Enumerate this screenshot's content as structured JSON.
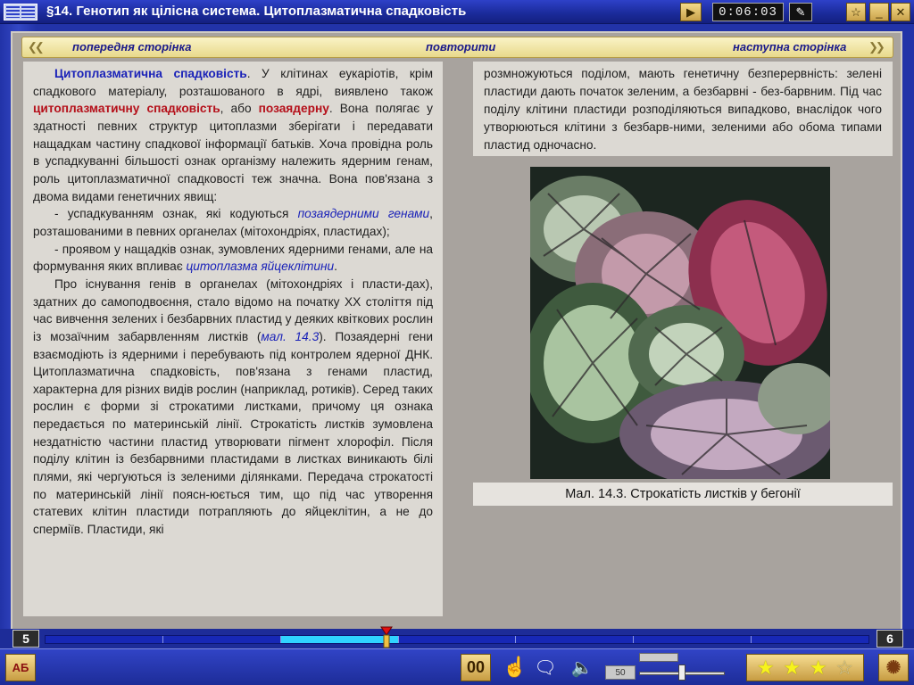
{
  "window": {
    "title": "§14. Генотип як цілісна система. Цитоплазматична спадковість",
    "timer": "0:06:03"
  },
  "nav": {
    "prev_label": "попередня сторінка",
    "repeat_label": "повторити",
    "next_label": "наступна сторінка"
  },
  "left_text": {
    "p1_term": "Цитоплазматична спадковість",
    "p1_a": ". У клітинах еукаріотів, крім спадкового матеріалу, розташованого в ядрі, виявлено також ",
    "p1_term2": "цитоплазматичну спадковість",
    "p1_b": ", або ",
    "p1_term3": "позаядерну",
    "p1_c": ". Вона полягає у здатності певних структур цитоплазми зберігати і передавати нащадкам частину спадкової інформації батьків. Хоча провідна роль в успадкуванні більшості ознак організму належить ядерним генам, роль цитоплазматичної спадковості теж значна. Вона пов'язана з двома видами генетичних явищ:",
    "p2_a": "- успадкуванням ознак, які кодуються ",
    "p2_term": "позаядерними генами",
    "p2_b": ", розташованими в певних органелах (мітохондріях, пластидах);",
    "p3_a": "- проявом у нащадків ознак, зумовлених ядерними генами, але на формування яких впливає ",
    "p3_term": "цитоплазма яйцеклітини",
    "p3_b": ".",
    "p4_a": "Про існування генів в органелах (мітохондріях і пласти-дах), здатних до самоподвоєння, стало відомо на початку XX століття під час вивчення зелених і безбарвних пластид у деяких квіткових рослин із мозаїчним забарвленням листків (",
    "p4_ref": "мал. 14.3",
    "p4_b": "). Позаядерні гени взаємодіють із ядерними і перебувають під контролем ядерної ДНК. Цитоплазматична спадковість, пов'язана з генами пластид, характерна для різних видів рослин (наприклад, ротиків). Серед таких рослин є форми зі строкатими листками, причому ця ознака передається по материнській лінії. Строкатість листків зумовлена нездатністю частини пластид утворювати пігмент хлорофіл. Після поділу клітин із безбарвними пластидами в листках виникають білі плями, які чергуються із зеленими ділянками. Передача строкатості по материнській лінії поясн-юється тим, що під час утворення статевих клітин пластиди потрапляють до яйцеклітин, а не до сперміїв. Пластиди, які"
  },
  "right_text": {
    "p1": "розмножуються поділом, мають генетичну безперервність: зелені пластиди дають початок зеленим, а безбарвні - без-барвним. Під час поділу клітини пластиди розподіляються випадково, внаслідок чого утворюються клітини з безбарв-ними, зеленими або обома типами пластид одночасно."
  },
  "figure": {
    "caption": "Мал. 14.3. Строкатість листків у бегонії"
  },
  "progress": {
    "prev_page": "5",
    "next_page": "6",
    "segments": 7,
    "active_segment": 3
  },
  "toolbar": {
    "dict_label": "АБ",
    "counter": "00",
    "volume": "50",
    "stars_filled": 3,
    "stars_total": 4
  },
  "colors": {
    "accent_blue": "#1a22b8",
    "accent_red": "#b5101a",
    "frame_blue": "#1b2a8c",
    "gold": "#e8d98b"
  }
}
